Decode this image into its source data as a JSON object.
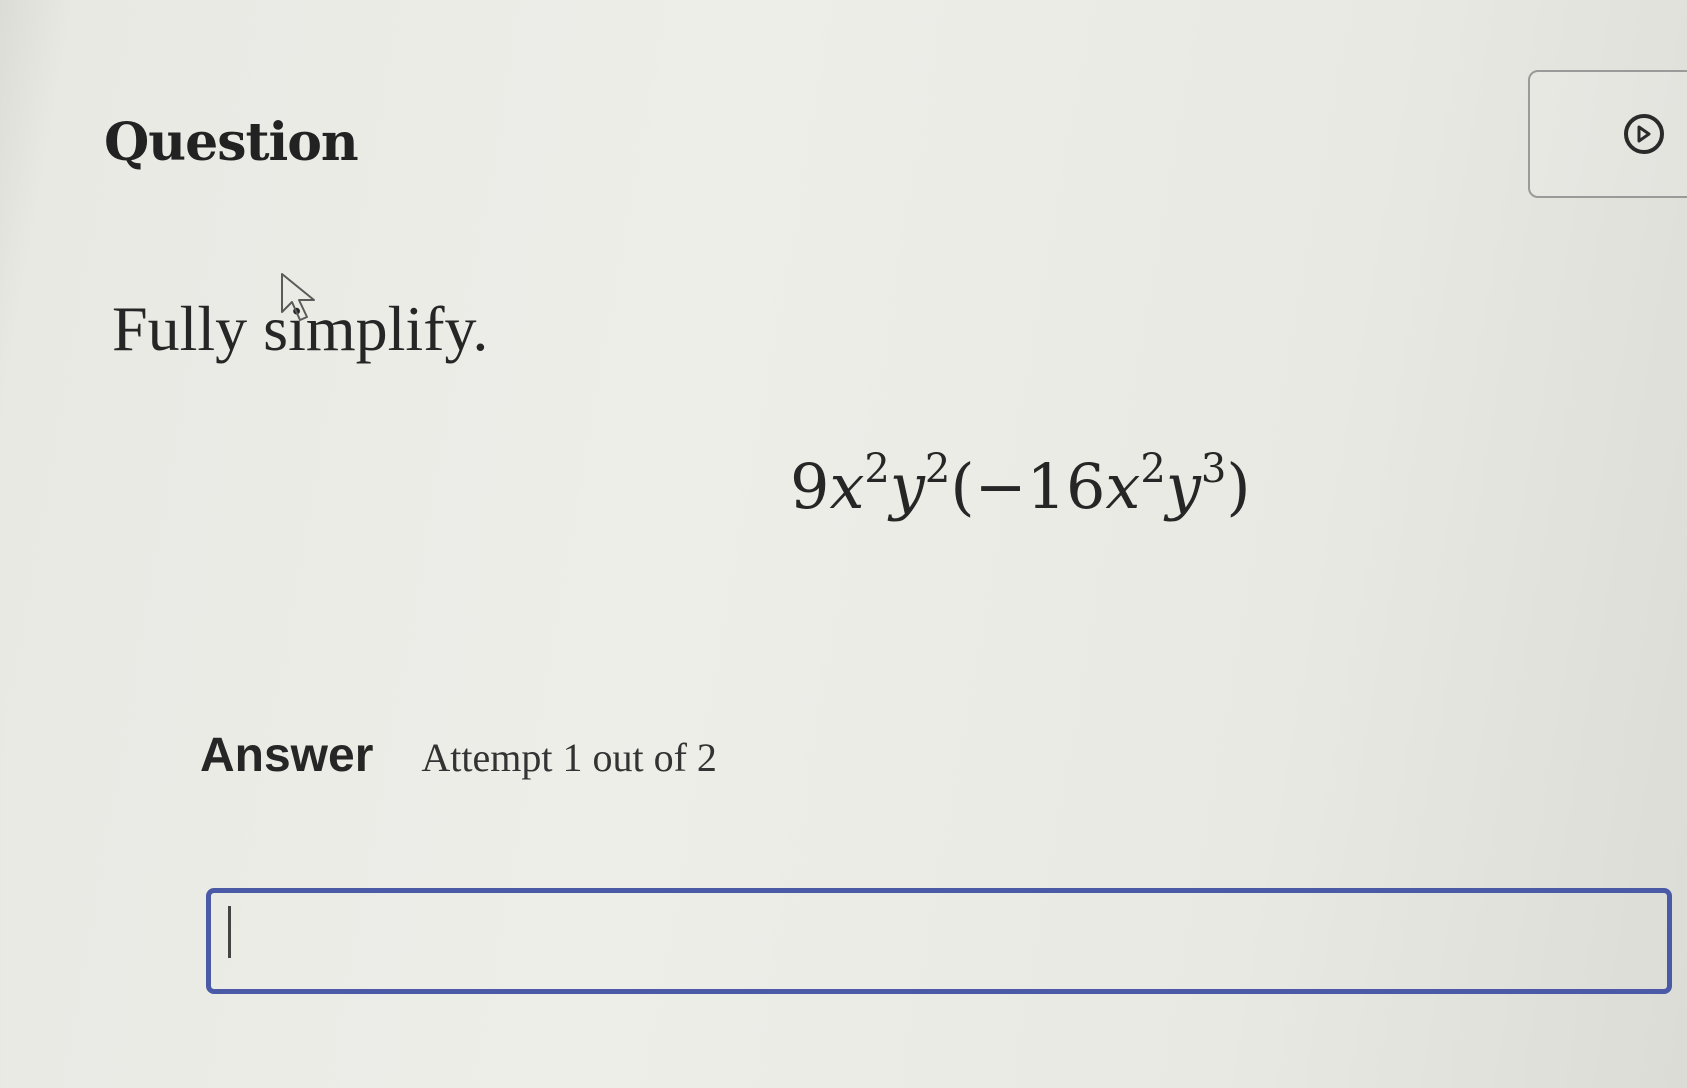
{
  "question": {
    "title": "Question"
  },
  "toolbar": {
    "play_icon": "play-circle-icon"
  },
  "prompt": "Fully simplify.",
  "expression": {
    "coef1": "9",
    "var1": "x",
    "exp1": "2",
    "var2": "y",
    "exp2": "2",
    "open": "(",
    "coef2": "−16",
    "var3": "x",
    "exp3": "2",
    "var4": "y",
    "exp4": "3",
    "close": ")"
  },
  "answer": {
    "label": "Answer",
    "attempt": "Attempt 1 out of 2",
    "value": ""
  },
  "colors": {
    "input_border": "#4a5aa6",
    "background": "#eeeee9"
  }
}
